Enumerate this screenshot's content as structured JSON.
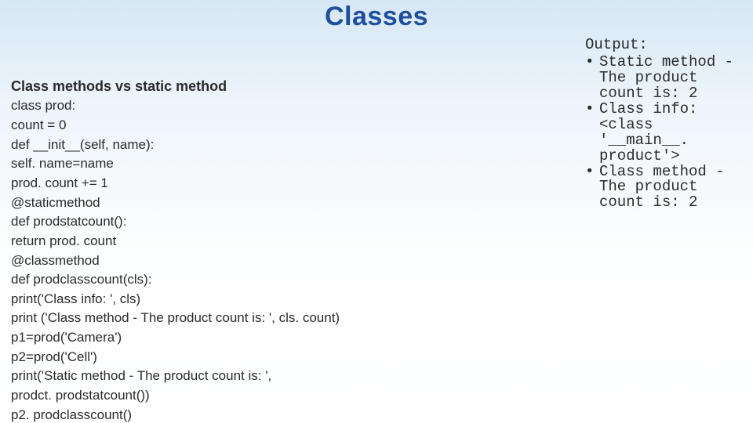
{
  "title": "Classes",
  "code": {
    "heading": "Class methods vs static method",
    "lines": [
      "class prod:",
      "count = 0",
      "def __init__(self, name):",
      "self. name=name",
      "prod. count += 1",
      "@staticmethod",
      "def prodstatcount():",
      "return prod. count",
      "@classmethod",
      "def prodclasscount(cls):",
      "print('Class info: ', cls)",
      "print ('Class method - The product count is: ', cls. count)",
      "p1=prod('Camera')",
      "p2=prod('Cell')",
      "print('Static method - The product count is: ',",
      "prodct. prodstatcount())",
      "p2. prodclasscount()"
    ]
  },
  "output": {
    "label": "Output:",
    "bullets": [
      "Static method - The product count is: 2",
      "Class info: <class '__main__. product'>",
      "Class method - The product count is: 2"
    ]
  }
}
